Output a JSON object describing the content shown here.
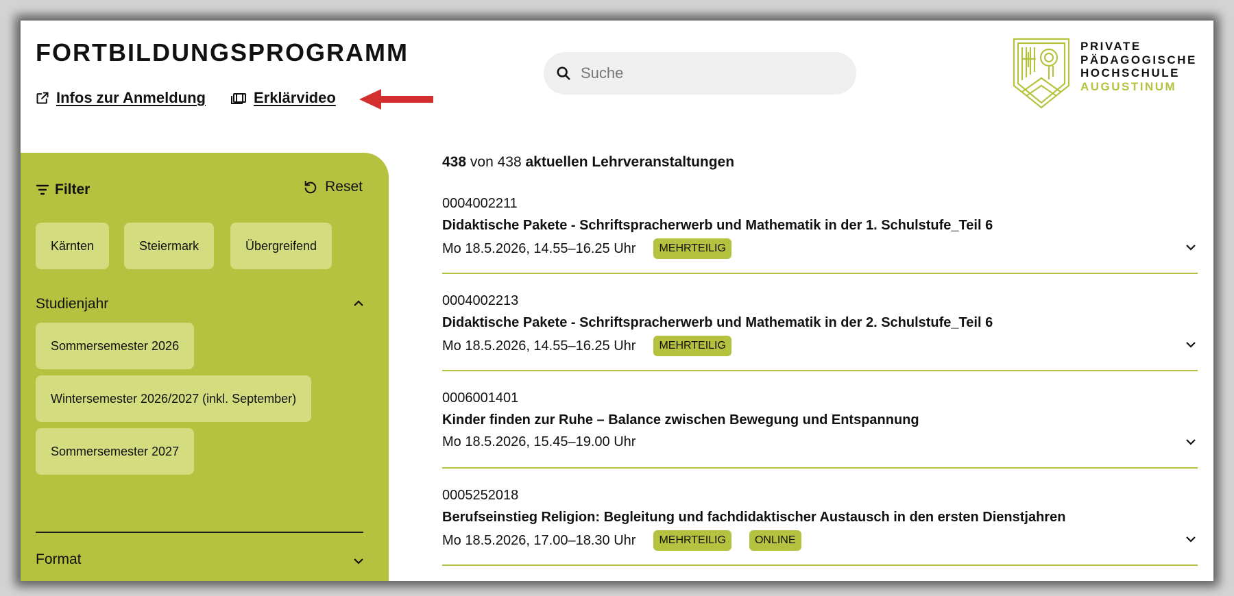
{
  "header": {
    "title": "FORTBILDUNGSPROGRAMM",
    "link_info": "Infos zur Anmeldung",
    "link_video": "Erklärvideo",
    "search_placeholder": "Suche",
    "logo_lines": [
      "PRIVATE",
      "PÄDAGOGISCHE",
      "HOCHSCHULE",
      "AUGUSTINUM"
    ]
  },
  "sidebar": {
    "filter_label": "Filter",
    "reset_label": "Reset",
    "regions": [
      "Kärnten",
      "Steiermark",
      "Übergreifend"
    ],
    "studienjahr_label": "Studienjahr",
    "semesters": [
      "Sommersemester 2026",
      "Wintersemester 2026/2027 (inkl. September)",
      "Sommersemester 2027"
    ],
    "format_label": "Format"
  },
  "results": {
    "shown": "438",
    "of_word": "von",
    "total": "438",
    "suffix": "aktuellen Lehrveranstaltungen",
    "items": [
      {
        "num": "0004002211",
        "title": "Didaktische Pakete - Schriftspracherwerb und Mathematik in der 1. Schulstufe_Teil 6",
        "time": "Mo 18.5.2026, 14.55–16.25 Uhr",
        "badges": [
          "MEHRTEILIG"
        ]
      },
      {
        "num": "0004002213",
        "title": "Didaktische Pakete - Schriftspracherwerb und Mathematik in der 2. Schulstufe_Teil 6",
        "time": "Mo 18.5.2026, 14.55–16.25 Uhr",
        "badges": [
          "MEHRTEILIG"
        ]
      },
      {
        "num": "0006001401",
        "title": "Kinder finden zur Ruhe – Balance zwischen Bewegung und Entspannung",
        "time": "Mo 18.5.2026, 15.45–19.00 Uhr",
        "badges": []
      },
      {
        "num": "0005252018",
        "title": "Berufseinstieg Religion: Begleitung und fachdidaktischer Austausch in den ersten Dienstjahren",
        "time": "Mo 18.5.2026, 17.00–18.30 Uhr",
        "badges": [
          "MEHRTEILIG",
          "ONLINE"
        ]
      }
    ]
  },
  "colors": {
    "accent": "#b5c23f",
    "chip": "#d3dc7e",
    "arrow": "#d32f2f"
  }
}
